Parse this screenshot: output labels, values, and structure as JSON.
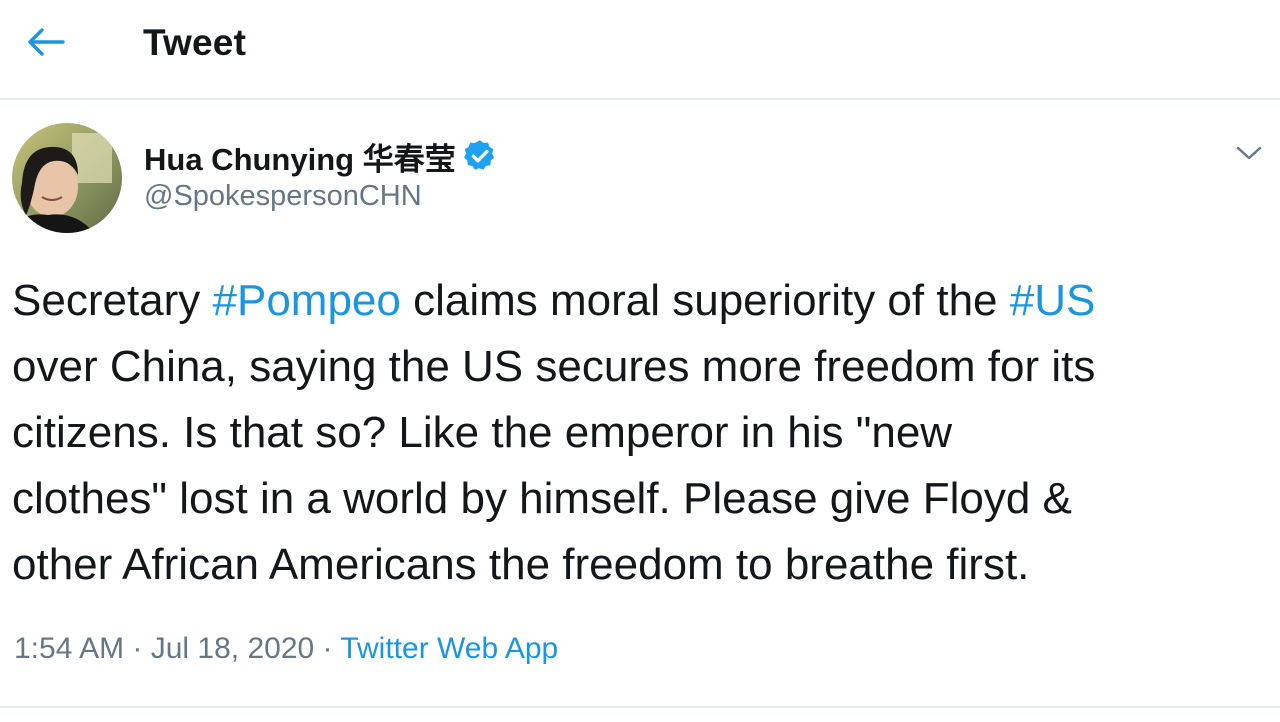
{
  "header": {
    "back_icon": "arrow-left-icon",
    "title": "Tweet"
  },
  "author": {
    "name": "Hua Chunying 华春莹",
    "handle": "@SpokespersonCHN",
    "verified_icon": "verified-badge-icon",
    "menu_icon": "chevron-down-icon"
  },
  "tweet": {
    "lines": [
      [
        {
          "text": "Secretary ",
          "hashtag": false
        },
        {
          "text": "#Pompeo",
          "hashtag": true
        },
        {
          "text": " claims moral superiority of the ",
          "hashtag": false
        },
        {
          "text": "#US",
          "hashtag": true
        }
      ],
      [
        {
          "text": "over China, saying the US secures more freedom for its",
          "hashtag": false
        }
      ],
      [
        {
          "text": "citizens. Is that so? Like the emperor in his \"new",
          "hashtag": false
        }
      ],
      [
        {
          "text": "clothes\" lost in a world by himself. Please give Floyd &",
          "hashtag": false
        }
      ],
      [
        {
          "text": "other African Americans the freedom to breathe first.",
          "hashtag": false
        }
      ]
    ]
  },
  "meta": {
    "time": "1:54 AM",
    "separator": " · ",
    "date": "Jul 18, 2020",
    "source": "Twitter Web App"
  },
  "colors": {
    "accent": "#1b95e0",
    "text_primary": "#14171a",
    "text_secondary": "#657786",
    "divider": "#e6ecf0"
  }
}
